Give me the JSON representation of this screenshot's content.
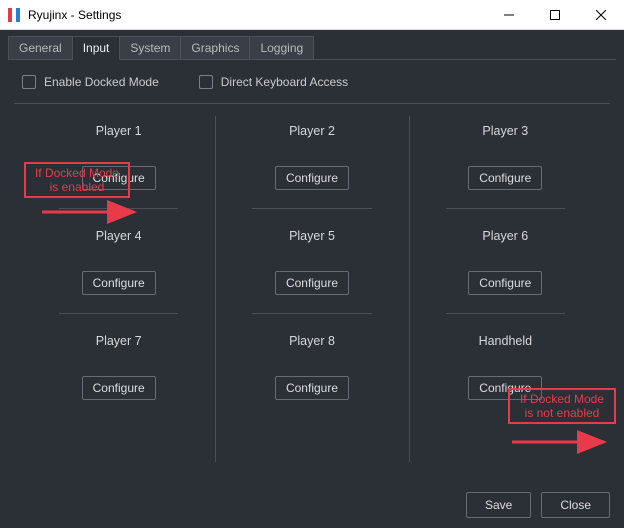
{
  "window": {
    "title": "Ryujinx - Settings"
  },
  "tabs": [
    "General",
    "Input",
    "System",
    "Graphics",
    "Logging"
  ],
  "active_tab_index": 1,
  "options": {
    "enable_docked_label": "Enable Docked Mode",
    "direct_keyboard_label": "Direct Keyboard Access"
  },
  "players": {
    "labels": [
      "Player 1",
      "Player 2",
      "Player 3",
      "Player 4",
      "Player 5",
      "Player 6",
      "Player 7",
      "Player 8",
      "Handheld"
    ],
    "configure_label": "Configure"
  },
  "footer": {
    "save": "Save",
    "close": "Close"
  },
  "annotations": {
    "enabled": "If Docked Mode\nis enabled",
    "not_enabled": "If Docked Mode\nis not enabled"
  }
}
